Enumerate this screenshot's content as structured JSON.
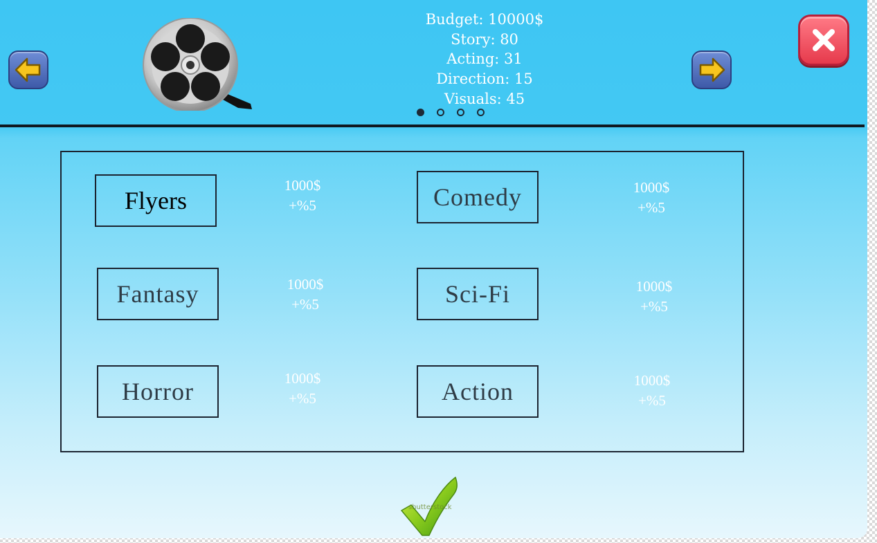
{
  "stats": {
    "budget": "Budget: 10000$",
    "story": "Story: 80",
    "acting": "Acting: 31",
    "direction": "Direction: 15",
    "visuals": "Visuals: 45"
  },
  "pager": {
    "pages": 4,
    "current": 1
  },
  "genres": [
    {
      "label": "Flyers",
      "price": "1000$",
      "bonus": "+%5",
      "selected": true
    },
    {
      "label": "Comedy",
      "price": "1000$",
      "bonus": "+%5",
      "selected": false
    },
    {
      "label": "Fantasy",
      "price": "1000$",
      "bonus": "+%5",
      "selected": false
    },
    {
      "label": "Sci-Fi",
      "price": "1000$",
      "bonus": "+%5",
      "selected": false
    },
    {
      "label": "Horror",
      "price": "1000$",
      "bonus": "+%5",
      "selected": false
    },
    {
      "label": "Action",
      "price": "1000$",
      "bonus": "+%5",
      "selected": false
    }
  ],
  "icons": {
    "prev": "left-arrow-icon",
    "next": "right-arrow-icon",
    "close": "close-icon",
    "logo": "film-reel-icon",
    "confirm": "checkmark-icon"
  },
  "watermark": "shutterstock",
  "colors": {
    "accent": "#3ec6f3",
    "close": "#e63a4c",
    "arrow": "#4b67b8",
    "confirm": "#7ac41e"
  }
}
